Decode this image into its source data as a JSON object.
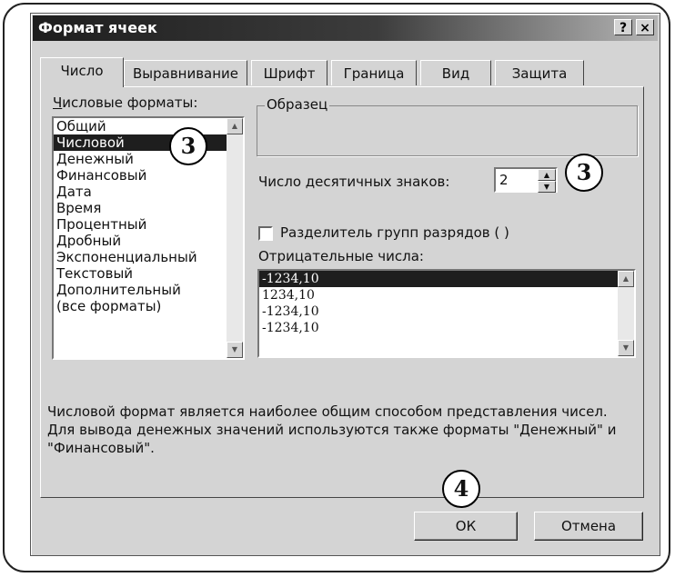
{
  "dialog": {
    "title": "Формат ячеек",
    "help_btn": "?",
    "close_btn": "×"
  },
  "tabs": [
    {
      "label": "Число",
      "active": true
    },
    {
      "label": "Выравнивание"
    },
    {
      "label": "Шрифт"
    },
    {
      "label": "Граница"
    },
    {
      "label": "Вид"
    },
    {
      "label": "Защита"
    }
  ],
  "formats": {
    "label": "Числовые форматы:",
    "items": [
      "Общий",
      "Числовой",
      "Денежный",
      "Финансовый",
      "Дата",
      "Время",
      "Процентный",
      "Дробный",
      "Экспоненциальный",
      "Текстовый",
      "Дополнительный",
      "(все форматы)"
    ],
    "selected": "Числовой"
  },
  "sample": {
    "label": "Образец",
    "value": ""
  },
  "decimals": {
    "label": "Число десятичных знаков:",
    "value": "2"
  },
  "separator": {
    "label": "Разделитель групп разрядов ( )",
    "checked": false
  },
  "negatives": {
    "label": "Отрицательные числа:",
    "items": [
      "-1234,10",
      "1234,10",
      "-1234,10",
      "-1234,10"
    ],
    "selected_index": 0
  },
  "description": "Числовой формат является наиболее общим способом представления чисел. Для вывода денежных значений используются также форматы \"Денежный\" и \"Финансовый\".",
  "buttons": {
    "ok": "ОК",
    "cancel": "Отмена"
  },
  "callouts": {
    "formats_step": "3",
    "decimals_step": "3",
    "ok_step": "4"
  }
}
